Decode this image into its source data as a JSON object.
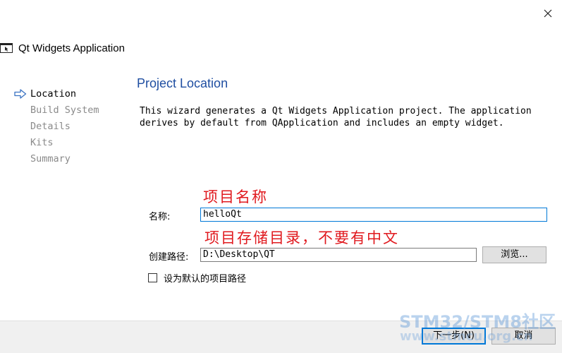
{
  "window": {
    "close_icon": "close-icon"
  },
  "header": {
    "title": "Qt Widgets Application",
    "icon": "app-window-icon"
  },
  "steps": [
    {
      "label": "Location",
      "current": true
    },
    {
      "label": "Build System",
      "current": false
    },
    {
      "label": "Details",
      "current": false
    },
    {
      "label": "Kits",
      "current": false
    },
    {
      "label": "Summary",
      "current": false
    }
  ],
  "main": {
    "title": "Project Location",
    "description": "This wizard generates a Qt Widgets Application project. The application\nderives by default from QApplication and includes an empty widget.",
    "annotations": {
      "name_note": "项目名称",
      "path_note": "项目存储目录，不要有中文"
    },
    "name_label": "名称:",
    "name_value": "helloQt",
    "path_label": "创建路径:",
    "path_value": "D:\\Desktop\\QT",
    "browse_label": "浏览...",
    "default_path_label": "设为默认的项目路径"
  },
  "footer": {
    "next_label": "下一步(N)",
    "cancel_label": "取消"
  },
  "watermark": {
    "line1": "STM32/STM8社区",
    "line2": "www.stmcu.org.cn"
  },
  "colors": {
    "accent": "#0078d7",
    "title_blue": "#1f4ea1",
    "annotation_red": "#e0191e"
  }
}
